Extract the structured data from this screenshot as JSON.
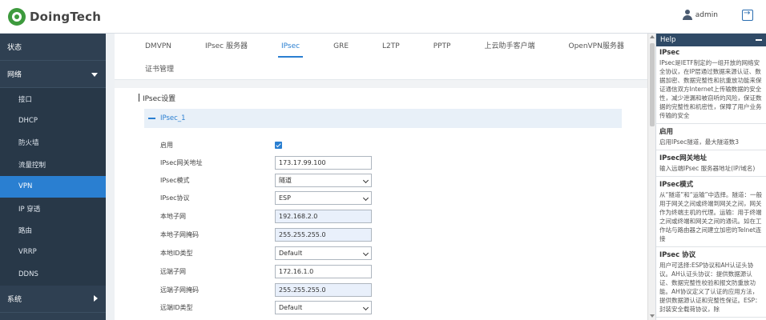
{
  "header": {
    "brand": "DoingTech",
    "user": "admin"
  },
  "sidebar": {
    "items": [
      {
        "label": "状态",
        "type": "top"
      },
      {
        "label": "网络",
        "type": "top-expanded"
      },
      {
        "label": "接口",
        "type": "sub"
      },
      {
        "label": "DHCP",
        "type": "sub"
      },
      {
        "label": "防火墙",
        "type": "sub"
      },
      {
        "label": "流量控制",
        "type": "sub"
      },
      {
        "label": "VPN",
        "type": "sub",
        "active": true
      },
      {
        "label": "IP 穿透",
        "type": "sub"
      },
      {
        "label": "路由",
        "type": "sub"
      },
      {
        "label": "VRRP",
        "type": "sub"
      },
      {
        "label": "DDNS",
        "type": "sub"
      },
      {
        "label": "系统",
        "type": "top-collapsed"
      }
    ]
  },
  "tabs": {
    "row1": [
      "DMVPN",
      "IPsec 服务器",
      "IPsec",
      "GRE",
      "L2TP",
      "PPTP",
      "上云助手客户端",
      "OpenVPN服务器"
    ],
    "active": "IPsec",
    "row2": "证书管理"
  },
  "main": {
    "section_title": "IPsec设置",
    "accordion_title": "IPsec_1",
    "form": {
      "enable_label": "启用",
      "enable_checked": true,
      "gateway_label": "IPsec网关地址",
      "gateway_value": "173.17.99.100",
      "mode_label": "IPsec模式",
      "mode_value": "隧道",
      "protocol_label": "IPsec协议",
      "protocol_value": "ESP",
      "local_subnet_label": "本地子网",
      "local_subnet_value": "192.168.2.0",
      "local_mask_label": "本地子网掩码",
      "local_mask_value": "255.255.255.0",
      "local_id_label": "本地ID类型",
      "local_id_value": "Default",
      "remote_subnet_label": "远端子网",
      "remote_subnet_value": "172.16.1.0",
      "remote_mask_label": "远端子网掩码",
      "remote_mask_value": "255.255.255.0",
      "remote_id_label": "远端ID类型",
      "remote_id_value": "Default"
    }
  },
  "help": {
    "title": "Help",
    "blocks": [
      {
        "title": "IPsec",
        "text": "IPsec是IETF制定的一组开放的网络安全协议，在IP层通过数据来源认证、数据加密、数据完整性和抗重放功能来保证通信双方Internet上传输数据的安全性，减少泄漏和被窃听的风险，保证数据的完整性和机密性，保障了用户业务传输的安全"
      },
      {
        "title": "启用",
        "text": "启用IPsec隧道，最大隧道数3"
      },
      {
        "title": "IPsec网关地址",
        "text": "输入远端IPsec 服务器地址(IP/域名)"
      },
      {
        "title": "IPsec模式",
        "text": "从“隧道”和“运输”中选择。隧道：一般用于网关之间或终端到网关之间，网关作为终端主机的代理。运输：用于终端之间或终端和网关之间的通讯。如在工作站与路由器之间建立加密的Telnet连接"
      },
      {
        "title": "IPsec 协议",
        "text": "用户可选择:ESP协议和AH认证头协议。AH认证头协议：提供数据源认证、数据完整性校验和报文防重放功能。AH协议定义了认证的应用方法，提供数据源认证和完整性保证。ESP：封装安全载荷协议，除"
      }
    ]
  }
}
